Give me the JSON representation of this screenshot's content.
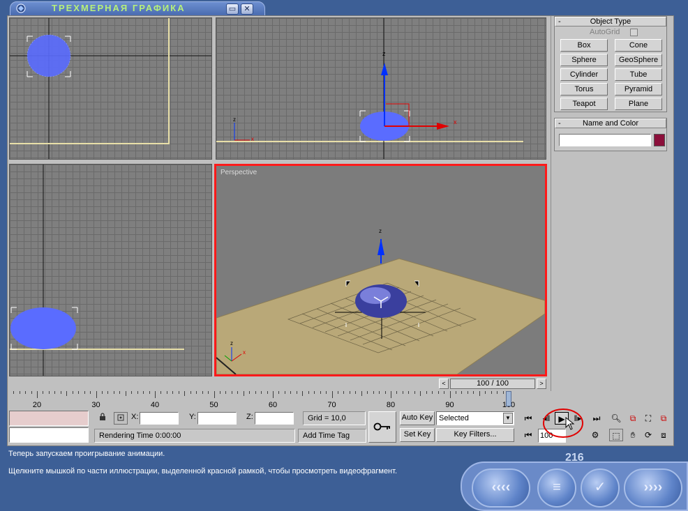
{
  "window": {
    "title": "ТРЕХМЕРНАЯ ГРАФИКА",
    "buttons": {
      "minimize": "▭",
      "close": "✕"
    }
  },
  "viewports": {
    "perspective_label": "Perspective"
  },
  "command_panel": {
    "object_type": {
      "title": "Object Type",
      "autogrid_label": "AutoGrid",
      "buttons": [
        "Box",
        "Cone",
        "Sphere",
        "GeoSphere",
        "Cylinder",
        "Tube",
        "Torus",
        "Pyramid",
        "Teapot",
        "Plane"
      ]
    },
    "name_color": {
      "title": "Name and Color",
      "name_value": "",
      "color": "#8b0f3a"
    },
    "collapse_symbol": "-"
  },
  "time_slider": {
    "counter": "100 / 100",
    "left_arrow": "<",
    "right_arrow": ">",
    "ticks": [
      "20",
      "30",
      "40",
      "50",
      "60",
      "70",
      "80",
      "90",
      "100"
    ]
  },
  "status": {
    "x_label": "X:",
    "y_label": "Y:",
    "z_label": "Z:",
    "x_value": "",
    "y_value": "",
    "z_value": "",
    "grid": "Grid = 10,0",
    "rendering_time": "Rendering Time  0:00:00",
    "add_time_tag": "Add Time Tag",
    "auto_key": "Auto Key",
    "set_key": "Set Key",
    "selected": "Selected",
    "key_filters": "Key Filters...",
    "current_frame": "100"
  },
  "lesson": {
    "line1": "Теперь запускаем проигрывание анимации.",
    "line2": "Щелкните мышкой по части иллюстрации, выделенной красной рамкой, чтобы просмотреть видеофрагмент.",
    "page_number": "216"
  },
  "icons": {
    "lock": "lock-icon",
    "key": "key-icon",
    "play": "play-icon",
    "zoom": "zoom-icon",
    "pan": "pan-hand-icon"
  }
}
